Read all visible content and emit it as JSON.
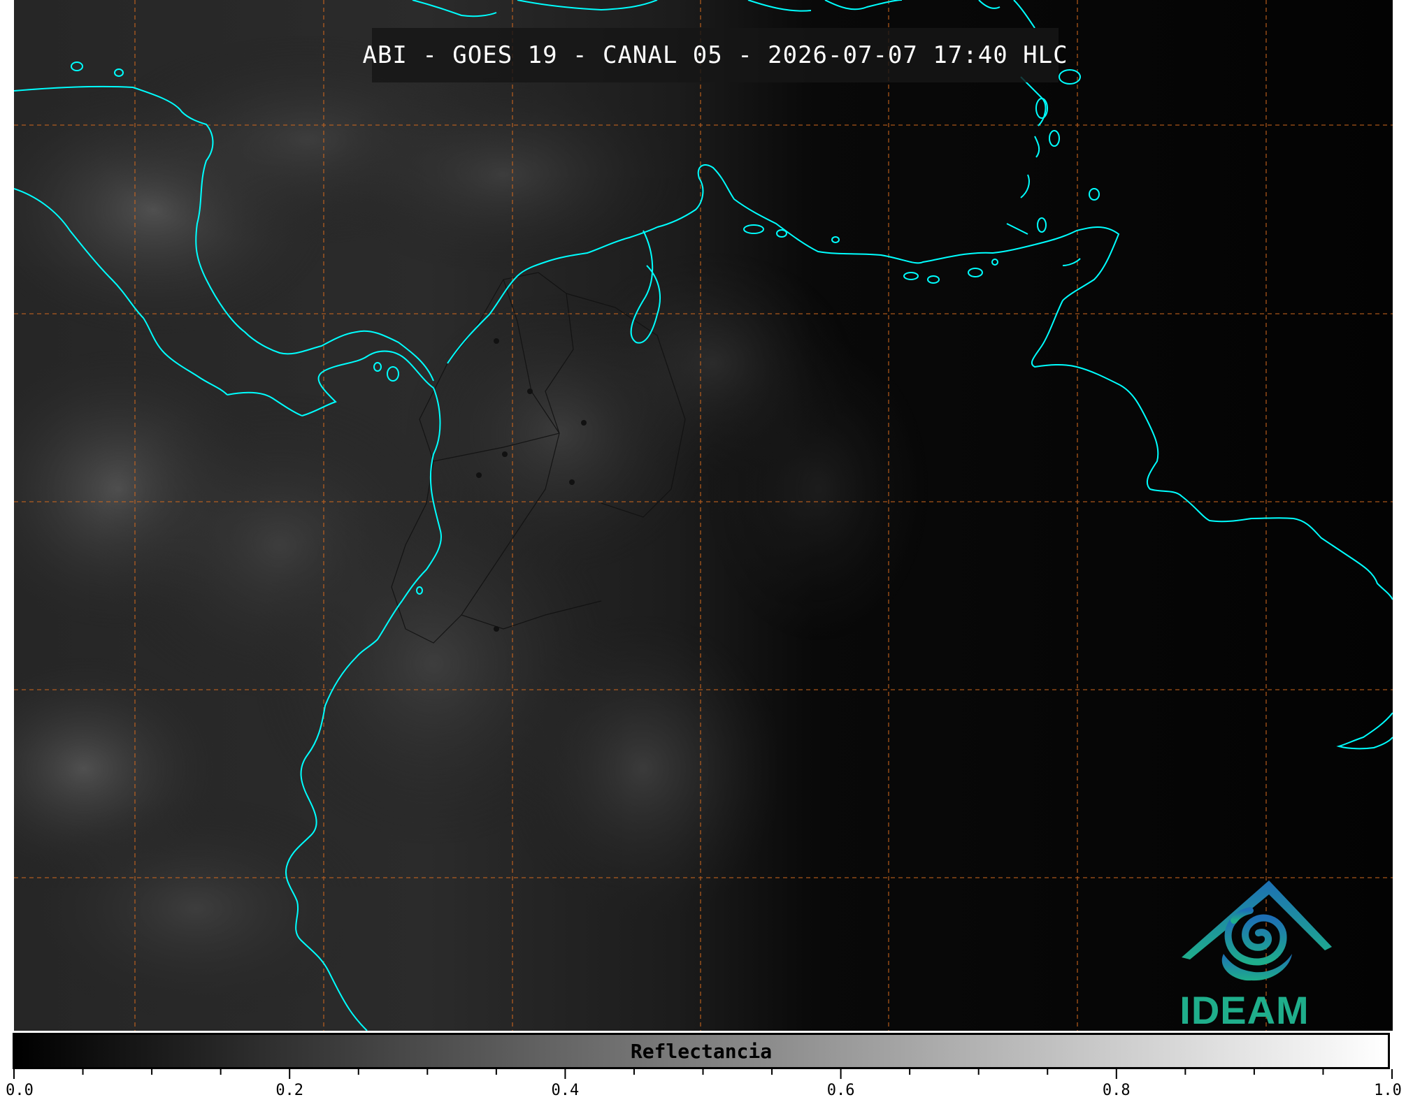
{
  "title": "ABI - GOES 19 - CANAL 05 - 2026-07-07 17:40 HLC",
  "logo": {
    "text": "IDEAM",
    "primary_color": "#1fae8b",
    "secondary_color": "#1d6fb5"
  },
  "colorbar": {
    "label": "Reflectancia",
    "ticks": [
      "0.0",
      "0.2",
      "0.4",
      "0.6",
      "0.8",
      "1.0"
    ],
    "range": [
      0.0,
      1.0
    ],
    "gradient": [
      "#000000",
      "#ffffff"
    ]
  },
  "map": {
    "background": "#050505",
    "coastline_color": "#00ffff",
    "gridline_color": "#d2691e",
    "borders_color": "#111111"
  }
}
